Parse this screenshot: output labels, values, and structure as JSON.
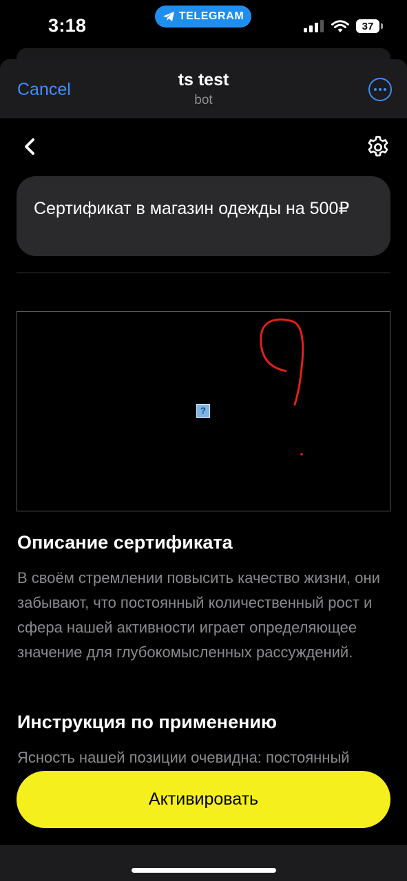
{
  "status_bar": {
    "time": "3:18",
    "app_pill": "TELEGRAM",
    "battery": "37"
  },
  "header": {
    "cancel_label": "Cancel",
    "title": "ts test",
    "subtitle": "bot"
  },
  "certificate": {
    "title": "Сертификат в магазин одежды на 500₽",
    "image_placeholder": "?"
  },
  "description": {
    "heading": "Описание сертификата",
    "text": "В своём стремлении повысить качество жизни, они забывают, что постоянный количественный рост и сфера нашей активности играет определяющее значение для глубокомысленных рассуждений."
  },
  "instructions": {
    "heading": "Инструкция по применению",
    "text": "Ясность нашей позиции очевидна: постоянный"
  },
  "actions": {
    "activate_label": "Активировать"
  },
  "colors": {
    "accent": "#3e8ef7",
    "button": "#f5ef1e",
    "telegram_pill": "#1f8ef1",
    "annotation": "#e0201a"
  }
}
